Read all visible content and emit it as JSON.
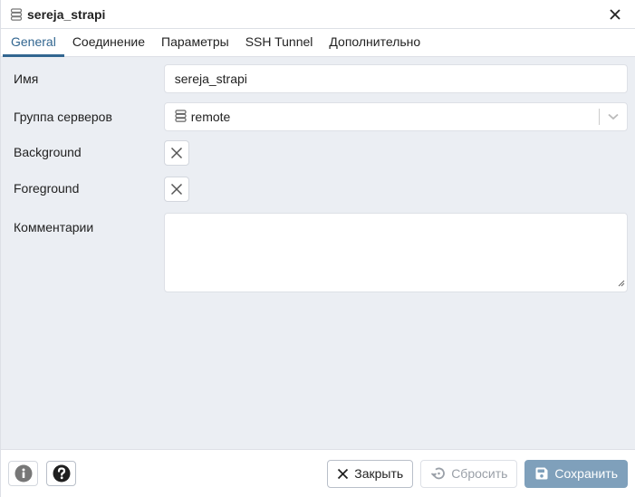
{
  "window": {
    "title": "sereja_strapi",
    "title_icon": "server-icon",
    "close_icon": "close-icon"
  },
  "tabs": [
    {
      "label": "General",
      "active": true
    },
    {
      "label": "Соединение",
      "active": false
    },
    {
      "label": "Параметры",
      "active": false
    },
    {
      "label": "SSH Tunnel",
      "active": false
    },
    {
      "label": "Дополнительно",
      "active": false
    }
  ],
  "form": {
    "name": {
      "label": "Имя",
      "value": "sereja_strapi"
    },
    "server_group": {
      "label": "Группа серверов",
      "value": "remote",
      "icon": "server-group-icon"
    },
    "background": {
      "label": "Background",
      "icon": "clear-color-icon"
    },
    "foreground": {
      "label": "Foreground",
      "icon": "clear-color-icon"
    },
    "comments": {
      "label": "Комментарии",
      "value": ""
    }
  },
  "footer": {
    "info_icon": "info-icon",
    "help_icon": "help-icon",
    "close_label": "Закрыть",
    "reset_label": "Сбросить",
    "save_label": "Сохранить"
  },
  "colors": {
    "accent": "#326690",
    "content_bg": "#ebeef3",
    "save_button": "#7fa0bb",
    "border": "#dde0e6"
  }
}
